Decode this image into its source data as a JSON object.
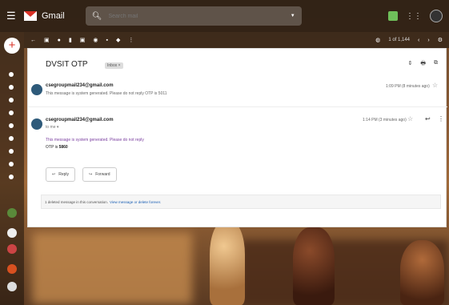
{
  "topbar": {
    "app_title": "Gmail",
    "search_placeholder": "Search mail"
  },
  "toolbar": {
    "pager": "1 of 1,144"
  },
  "email": {
    "subject": "DVSIT OTP",
    "label_badge": "Inbox ×",
    "messages": [
      {
        "sender": "csegroupmail234@gmail.com",
        "snippet": "This message is system generated. Please do not reply OTP is 5011",
        "time": "1:09 PM (8 minutes ago)"
      },
      {
        "sender": "csegroupmail234@gmail.com",
        "to": "to me ▾",
        "time": "1:14 PM (3 minutes ago)",
        "body_line1": "This message is system generated. Please do not reply",
        "otp_prefix": "OTP is",
        "otp_value": "5860"
      }
    ],
    "reply_label": "Reply",
    "forward_label": "Forward",
    "deleted_text": "1 deleted message in this conversation.",
    "deleted_link": "View message or delete forever."
  },
  "colors": {
    "gmail_red": "#d93025",
    "link_blue": "#1a5fb4",
    "body_purple": "#7b3fa0"
  }
}
